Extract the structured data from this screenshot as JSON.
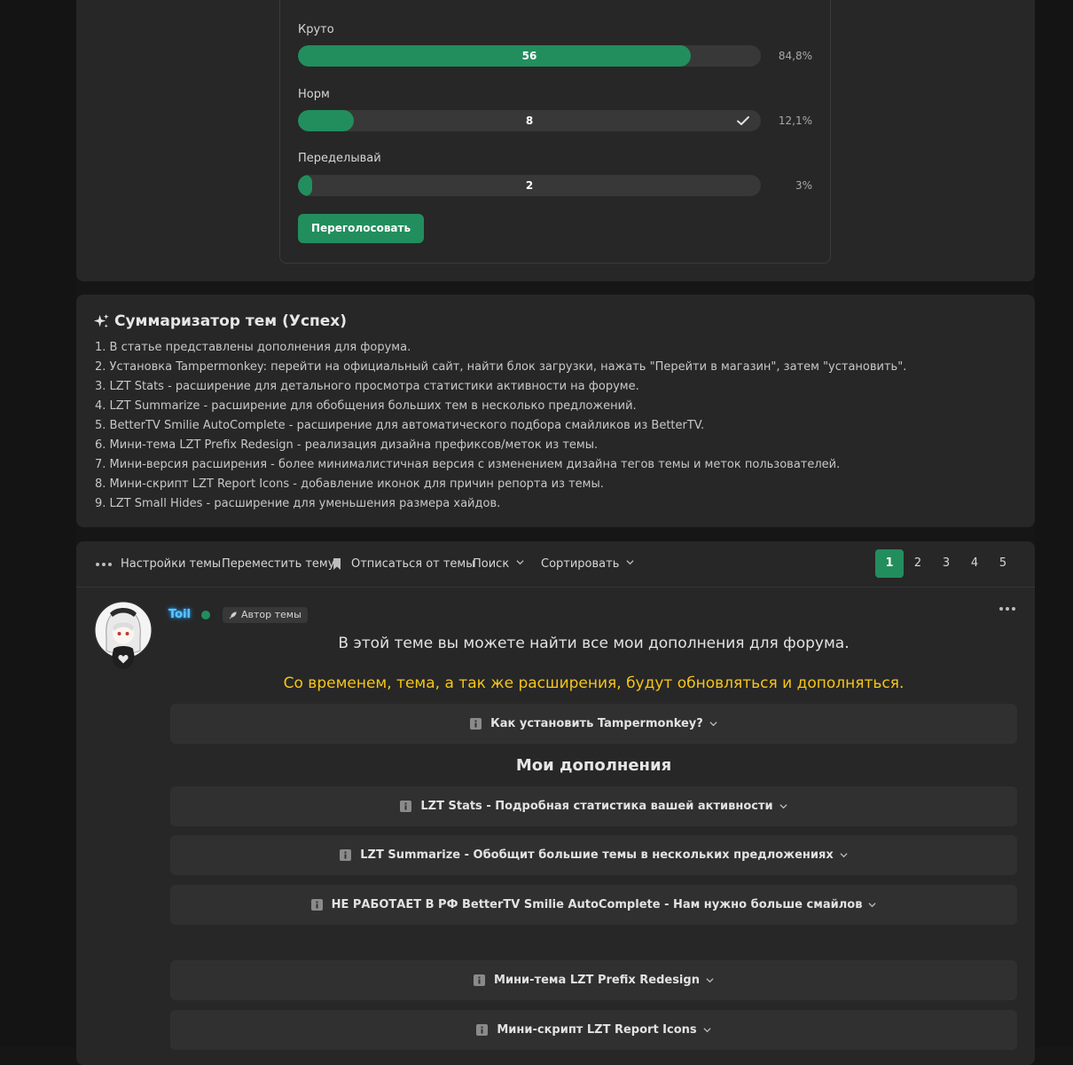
{
  "poll": {
    "options": [
      {
        "label": "Круто",
        "votes": "56",
        "percent": "84,8%",
        "fraction": 0.848,
        "voted": false
      },
      {
        "label": "Норм",
        "votes": "8",
        "percent": "12,1%",
        "fraction": 0.121,
        "voted": true
      },
      {
        "label": "Переделывай",
        "votes": "2",
        "percent": "3%",
        "fraction": 0.03,
        "voted": false
      }
    ],
    "revote_label": "Переголосовать"
  },
  "summary": {
    "title": "Суммаризатор тем (Успех)",
    "items": [
      "1. В статье представлены дополнения для форума.",
      "2. Установка Tampermonkey: перейти на официальный сайт, найти блок загрузки, нажать \"Перейти в магазин\", затем \"установить\".",
      "3. LZT Stats - расширение для детального просмотра статистики активности на форуме.",
      "4. LZT Summarize - расширение для обобщения больших тем в несколько предложений.",
      "5. BetterTV Smilie AutoComplete - расширение для автоматического подбора смайликов из BetterTV.",
      "6. Мини-тема LZT Prefix Redesign - реализация дизайна префиксов/меток из темы.",
      "7. Мини-версия расширения - более минималистичная версия с изменением дизайна тегов темы и меток пользователей.",
      "8. Мини-скрипт LZT Report Icons - добавление иконок для причин репорта из темы.",
      "9. LZT Small Hides - расширение для уменьшения размера хайдов."
    ]
  },
  "toolbar": {
    "settings": "Настройки темы",
    "move": "Переместить тему",
    "unsubscribe": "Отписаться от темы",
    "search": "Поиск",
    "sort": "Сортировать",
    "pages": [
      "1",
      "2",
      "3",
      "4",
      "5"
    ],
    "current_page": "1"
  },
  "post": {
    "username": "Toil",
    "author_badge": "Автор темы",
    "line1": "В этой теме вы можете найти все мои дополнения для форума.",
    "line2": "Со временем, тема, а так же расширения, будут обновляться и дополняться.",
    "line2_color": "#f5c518",
    "spoiler_install": "Как установить Tampermonkey?",
    "addons_heading": "Мои дополнения",
    "spoilers": [
      "LZT Stats - Подробная статистика вашей активности",
      "LZT Summarize - Обобщит большие темы в нескольких предложениях",
      "НЕ РАБОТАЕТ В РФ BetterTV Smilie AutoComplete - Нам нужно больше смайлов",
      "Мини-тема LZT Prefix Redesign",
      "Мини-скрипт LZT Report Icons"
    ]
  },
  "colors": {
    "accent": "#228e5d",
    "username": "#5dc4ff"
  }
}
